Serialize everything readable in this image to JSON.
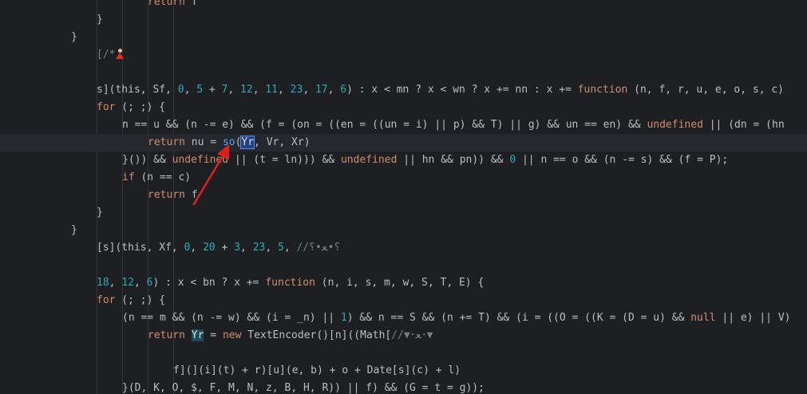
{
  "editor": {
    "lines": [
      [
        {
          "t": "return",
          "c": "kw"
        },
        {
          "t": " f",
          "c": "id"
        }
      ],
      [
        {
          "t": "}",
          "c": "id"
        }
      ],
      [
        {
          "t": "}",
          "c": "id"
        }
      ],
      [
        {
          "t": "[/*",
          "c": "cmt"
        },
        {
          "icon": "person"
        }
      ],
      [],
      [
        {
          "t": "s](this, Sf, ",
          "c": "id"
        },
        {
          "t": "0",
          "c": "num"
        },
        {
          "t": ", ",
          "c": "id"
        },
        {
          "t": "5",
          "c": "num"
        },
        {
          "t": " + ",
          "c": "id"
        },
        {
          "t": "7",
          "c": "num"
        },
        {
          "t": ", ",
          "c": "id"
        },
        {
          "t": "12",
          "c": "num"
        },
        {
          "t": ", ",
          "c": "id"
        },
        {
          "t": "11",
          "c": "num"
        },
        {
          "t": ", ",
          "c": "id"
        },
        {
          "t": "23",
          "c": "num"
        },
        {
          "t": ", ",
          "c": "id"
        },
        {
          "t": "17",
          "c": "num"
        },
        {
          "t": ", ",
          "c": "id"
        },
        {
          "t": "6",
          "c": "num"
        },
        {
          "t": ") : x < mn ? x < wn ? x += nn : x += ",
          "c": "id"
        },
        {
          "t": "function",
          "c": "kw"
        },
        {
          "t": " (n, f, r, u, e, o, s, c)",
          "c": "id"
        }
      ],
      [
        {
          "t": "for",
          "c": "kw"
        },
        {
          "t": " (; ;) {",
          "c": "id"
        }
      ],
      [
        {
          "t": "n == u && (n -= e) && (f = (on = ((en = ((un = i) || p) && T) || g) && un == en) && ",
          "c": "id"
        },
        {
          "t": "undefined",
          "c": "kw"
        },
        {
          "t": " || (dn = (hn",
          "c": "id"
        }
      ],
      [
        {
          "t": "return",
          "c": "kw"
        },
        {
          "t": " nu = ",
          "c": "id"
        },
        {
          "t": "so",
          "c": "fn"
        },
        {
          "t": "(",
          "c": "id"
        },
        {
          "t": "Yr",
          "c": "id",
          "hl": "sel"
        },
        {
          "t": ", Vr, Xr)",
          "c": "id"
        }
      ],
      [
        {
          "t": "}()) && ",
          "c": "id"
        },
        {
          "t": "undefined",
          "c": "kw"
        },
        {
          "t": " || (t = ln))) && ",
          "c": "id"
        },
        {
          "t": "undefined",
          "c": "kw"
        },
        {
          "t": " || hn && pn)) && ",
          "c": "id"
        },
        {
          "t": "0",
          "c": "num"
        },
        {
          "t": " || n == o && (n -= s) && (f = P);",
          "c": "id"
        }
      ],
      [
        {
          "t": "if",
          "c": "kw"
        },
        {
          "t": " (n == c)",
          "c": "id"
        }
      ],
      [
        {
          "t": "return",
          "c": "kw"
        },
        {
          "t": " f",
          "c": "id"
        }
      ],
      [
        {
          "t": "}",
          "c": "id"
        }
      ],
      [
        {
          "t": "}",
          "c": "id"
        }
      ],
      [
        {
          "t": "[s](this, Xf, ",
          "c": "id"
        },
        {
          "t": "0",
          "c": "num"
        },
        {
          "t": ", ",
          "c": "id"
        },
        {
          "t": "20",
          "c": "num"
        },
        {
          "t": " + ",
          "c": "id"
        },
        {
          "t": "3",
          "c": "num"
        },
        {
          "t": ", ",
          "c": "id"
        },
        {
          "t": "23",
          "c": "num"
        },
        {
          "t": ", ",
          "c": "id"
        },
        {
          "t": "5",
          "c": "num"
        },
        {
          "t": ", ",
          "c": "id"
        },
        {
          "t": "//؟•ﻌ•؟",
          "c": "cmt"
        }
      ],
      [],
      [
        {
          "t": "18",
          "c": "num"
        },
        {
          "t": ", ",
          "c": "id"
        },
        {
          "t": "12",
          "c": "num"
        },
        {
          "t": ", ",
          "c": "id"
        },
        {
          "t": "6",
          "c": "num"
        },
        {
          "t": ") : x < bn ? x += ",
          "c": "id"
        },
        {
          "t": "function",
          "c": "kw"
        },
        {
          "t": " (n, i, s, m, w, S, T, E) {",
          "c": "id"
        }
      ],
      [
        {
          "t": "for",
          "c": "kw"
        },
        {
          "t": " (; ;) {",
          "c": "id"
        }
      ],
      [
        {
          "t": "(n == m && (n -= w) && (i = _n) || ",
          "c": "id"
        },
        {
          "t": "1",
          "c": "num"
        },
        {
          "t": ") && n == S && (n += T) && (i = ((O = ((K = (D = u) && ",
          "c": "id"
        },
        {
          "t": "null",
          "c": "kw"
        },
        {
          "t": " || e) || V)",
          "c": "id"
        }
      ],
      [
        {
          "t": "return",
          "c": "kw"
        },
        {
          "t": " ",
          "c": "id"
        },
        {
          "t": "Yr",
          "c": "id",
          "hl": "read"
        },
        {
          "t": " = ",
          "c": "id"
        },
        {
          "t": "new",
          "c": "kw"
        },
        {
          "t": " TextEncoder()[n]((Math[",
          "c": "id"
        },
        {
          "t": "//▼･ﻌ･▼",
          "c": "cmt"
        }
      ],
      [],
      [
        {
          "t": "f](](i](t) + r)[u](e, b) + o + Date[s](c) + l)",
          "c": "id"
        }
      ],
      [
        {
          "t": "}(D, K, O, $, F, M, N, z, B, H, R)) || f) && (G = t = g));",
          "c": "id"
        }
      ]
    ]
  }
}
